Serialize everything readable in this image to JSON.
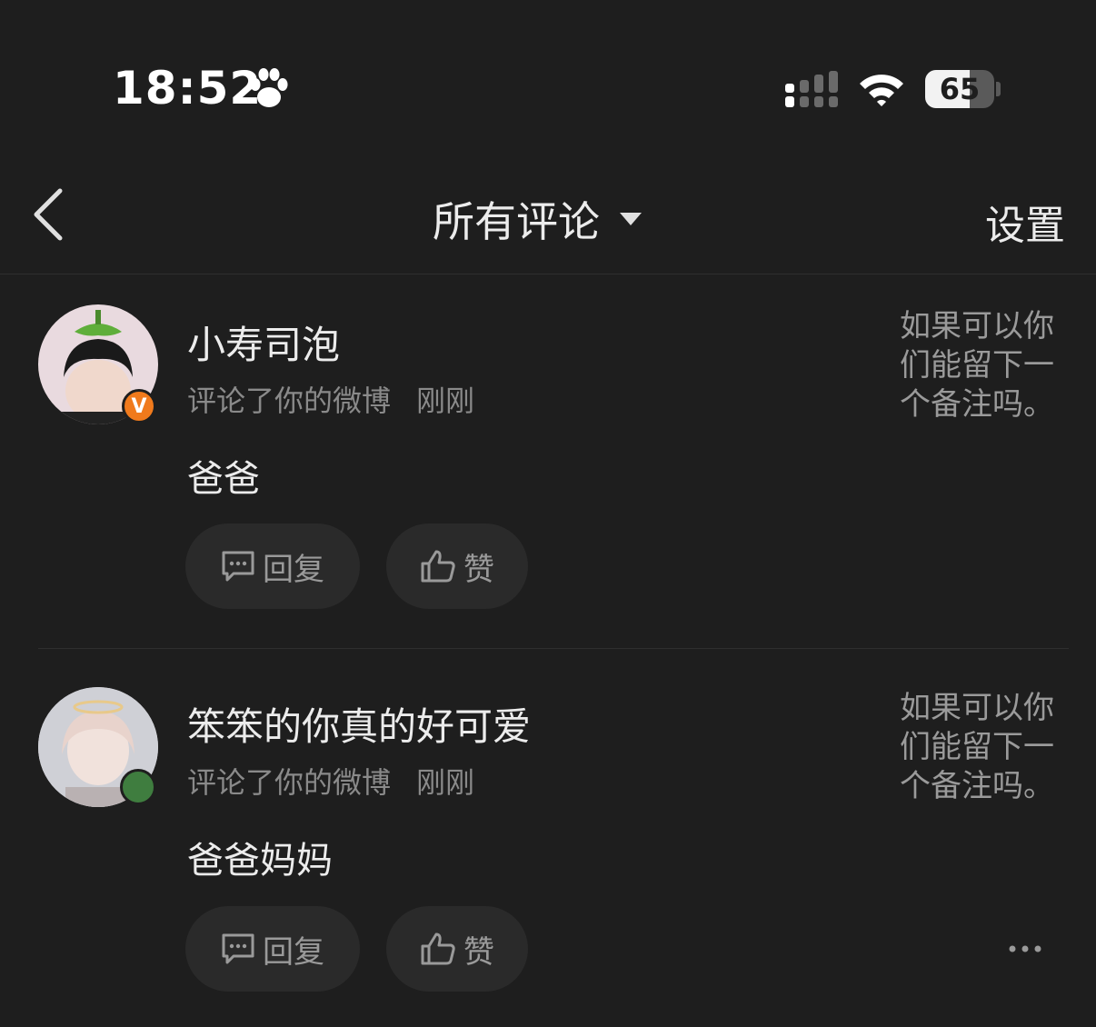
{
  "status_bar": {
    "time": "18:52",
    "battery_level": "65",
    "battery_fraction": 0.65
  },
  "nav": {
    "title": "所有评论",
    "settings_label": "设置"
  },
  "comments": [
    {
      "username": "小寿司泡",
      "action": "评论了你的微博",
      "time_ago": "刚刚",
      "text": "爸爸",
      "quoted_post": "如果可以你们能留下一个备注吗。",
      "reply_label": "回复",
      "like_label": "赞",
      "badge": "V",
      "badge_color": "#f07a1c"
    },
    {
      "username": "笨笨的你真的好可爱",
      "action": "评论了你的微博",
      "time_ago": "刚刚",
      "text": "爸爸妈妈",
      "quoted_post": "如果可以你们能留下一个备注吗。",
      "reply_label": "回复",
      "like_label": "赞",
      "badge_color": "#3f7d3f"
    }
  ],
  "colors": {
    "background": "#1e1e1e",
    "pill_background": "#2a2a2a",
    "secondary_text": "#8a8a8a"
  }
}
